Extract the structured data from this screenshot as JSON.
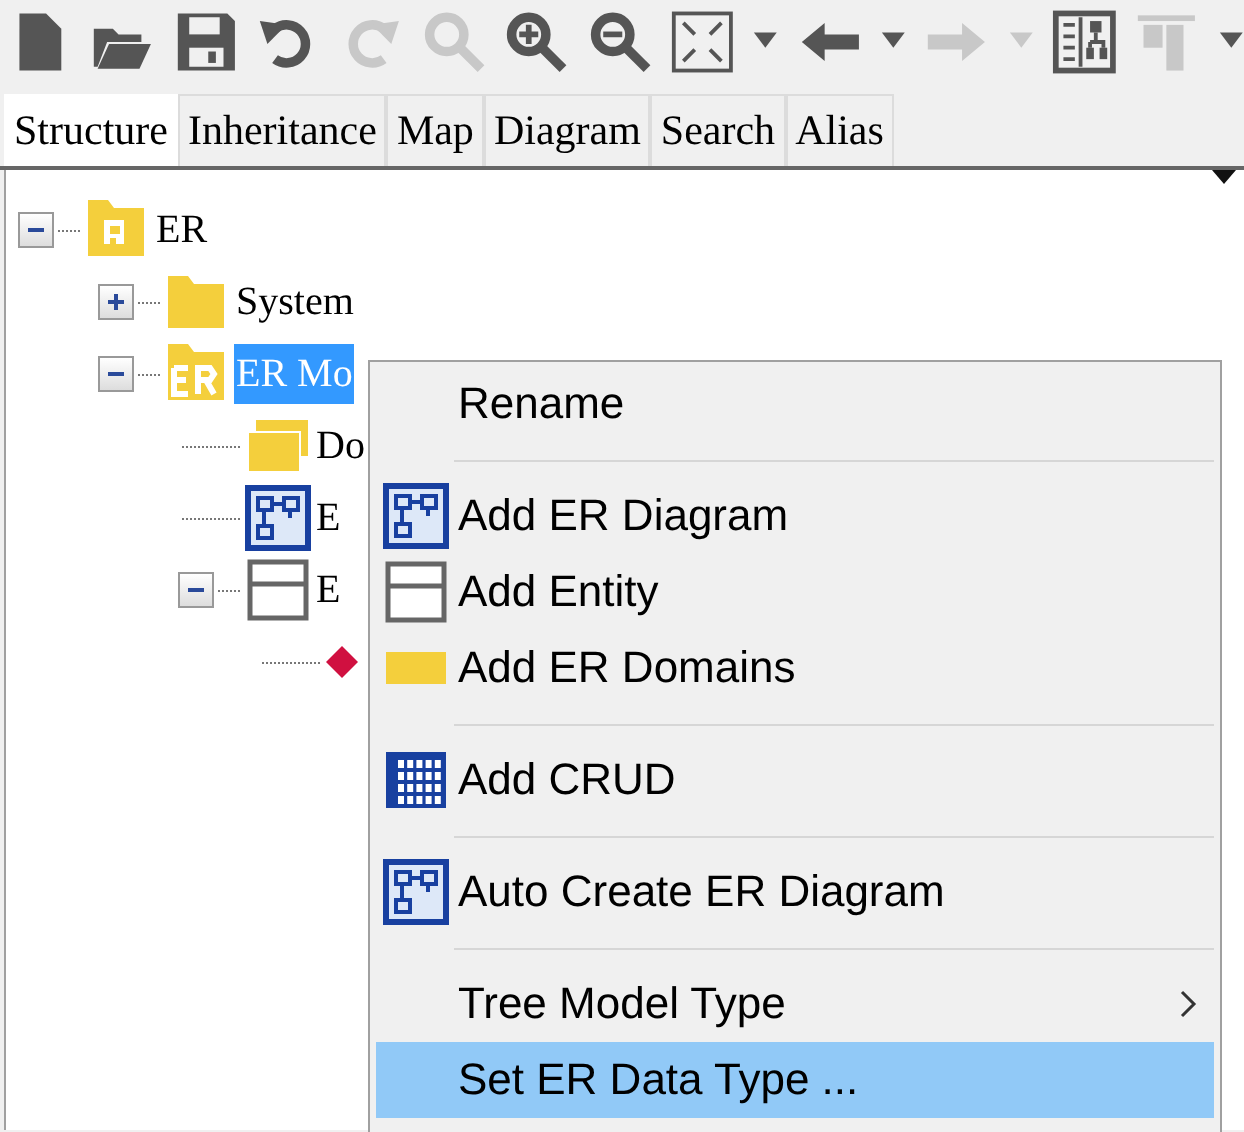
{
  "toolbar": [
    {
      "kind": "new",
      "disabled": false
    },
    {
      "kind": "open",
      "disabled": false
    },
    {
      "kind": "save",
      "disabled": false
    },
    {
      "kind": "undo",
      "disabled": false
    },
    {
      "kind": "redo",
      "disabled": true
    },
    {
      "kind": "find",
      "disabled": true
    },
    {
      "kind": "zoom-in",
      "disabled": false
    },
    {
      "kind": "zoom-out",
      "disabled": false
    },
    {
      "kind": "fit",
      "disabled": false
    },
    {
      "kind": "dropdown",
      "disabled": false
    },
    {
      "kind": "back",
      "disabled": false
    },
    {
      "kind": "dropdown",
      "disabled": false
    },
    {
      "kind": "forward",
      "disabled": true
    },
    {
      "kind": "dropdown",
      "disabled": true
    },
    {
      "kind": "layout",
      "disabled": false
    },
    {
      "kind": "align",
      "disabled": true
    },
    {
      "kind": "dropdown",
      "disabled": false
    }
  ],
  "tabs": [
    {
      "label": "Structure",
      "selected": true
    },
    {
      "label": "Inheritance",
      "selected": false
    },
    {
      "label": "Map",
      "selected": false
    },
    {
      "label": "Diagram",
      "selected": false
    },
    {
      "label": "Search",
      "selected": false
    },
    {
      "label": "Alias",
      "selected": false
    }
  ],
  "tree": [
    {
      "label": "ER",
      "kind": "project",
      "selected": false,
      "expanded": true,
      "children": [
        {
          "label": "System",
          "kind": "folder",
          "selected": false,
          "expanded": false
        },
        {
          "label": "ER Mo",
          "kind": "model",
          "selected": true,
          "expanded": true,
          "children": [
            {
              "label": "Do",
              "kind": "domains",
              "selected": false
            },
            {
              "label": "E",
              "kind": "diagram",
              "selected": false
            },
            {
              "label": "E",
              "kind": "entity",
              "selected": false,
              "expanded": true,
              "children": [
                {
                  "kind": "relation",
                  "selected": false
                }
              ]
            }
          ]
        }
      ]
    }
  ],
  "context_menu": [
    {
      "kind": "plain",
      "label": "Rename",
      "selected": false
    },
    {
      "kind": "separator"
    },
    {
      "kind": "diagram",
      "label": "Add ER Diagram",
      "selected": false
    },
    {
      "kind": "entity",
      "label": "Add Entity",
      "selected": false
    },
    {
      "kind": "domains",
      "label": "Add ER Domains",
      "selected": false
    },
    {
      "kind": "separator"
    },
    {
      "kind": "crud",
      "label": "Add CRUD",
      "selected": false
    },
    {
      "kind": "separator"
    },
    {
      "kind": "diagram",
      "label": "Auto Create ER Diagram",
      "selected": false
    },
    {
      "kind": "separator"
    },
    {
      "kind": "plain",
      "label": "Tree Model Type",
      "selected": false,
      "has_submenu": true
    },
    {
      "kind": "plain",
      "label": "Set ER Data Type ...",
      "selected": true
    }
  ]
}
